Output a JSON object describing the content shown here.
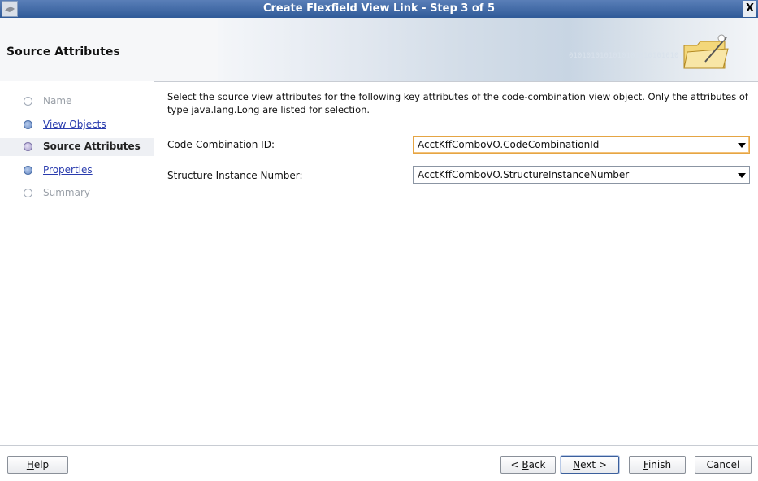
{
  "window": {
    "title": "Create Flexfield View Link - Step 3 of 5",
    "close_glyph": "X"
  },
  "header": {
    "page_title": "Source Attributes",
    "decorative_binary": "0101010101010101010101010"
  },
  "nav": {
    "items": [
      {
        "label": "Name",
        "state": "disabled"
      },
      {
        "label": "View Objects",
        "state": "link"
      },
      {
        "label": "Source Attributes",
        "state": "current"
      },
      {
        "label": "Properties",
        "state": "link"
      },
      {
        "label": "Summary",
        "state": "disabled"
      }
    ]
  },
  "main": {
    "instructions": "Select the source view attributes for the following key attributes of the code-combination view object. Only the attributes of type java.lang.Long are listed for selection.",
    "fields": [
      {
        "label": "Code-Combination ID:",
        "value": "AcctKffComboVO.CodeCombinationId"
      },
      {
        "label": "Structure Instance Number:",
        "value": "AcctKffComboVO.StructureInstanceNumber"
      }
    ]
  },
  "footer": {
    "help": {
      "mnemonic": "H",
      "rest": "elp"
    },
    "back": {
      "prefix": "< ",
      "mnemonic": "B",
      "rest": "ack"
    },
    "next": {
      "mnemonic": "N",
      "rest": "ext >"
    },
    "finish": {
      "mnemonic": "F",
      "rest": "inish"
    },
    "cancel": "Cancel"
  },
  "colors": {
    "title_bar": "#2f5a98",
    "link": "#2a3cae",
    "focus_border": "#e5a544",
    "nav_current_dot": "#a39bc8"
  },
  "icons": {
    "window": "app-icon",
    "banner": "folder-icon",
    "dropdown": "chevron-down-icon"
  }
}
